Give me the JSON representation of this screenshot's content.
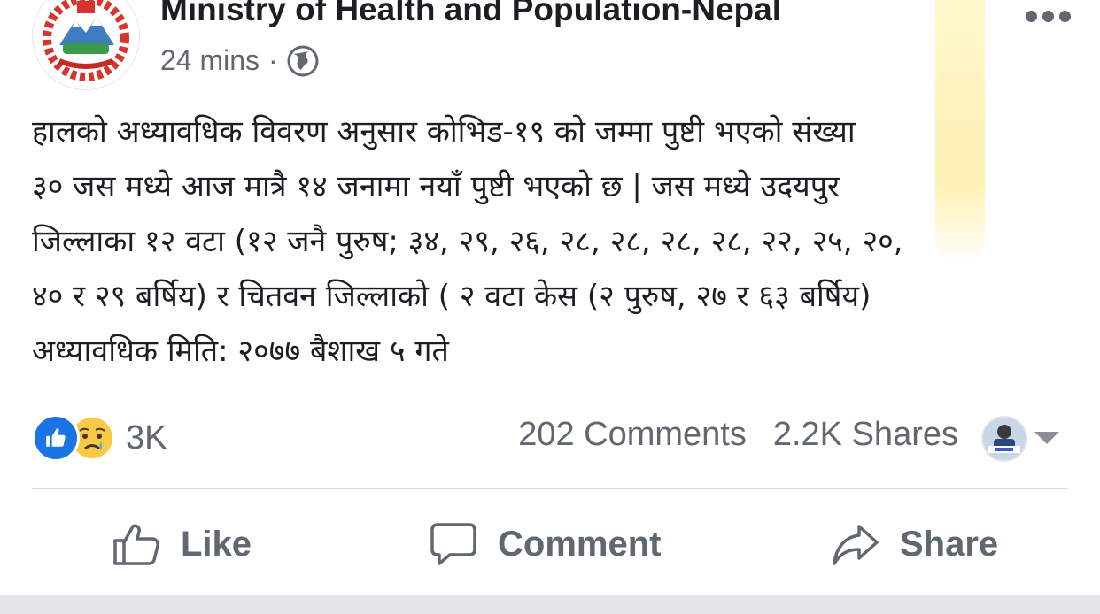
{
  "post": {
    "page_name": "Ministry of Health and Population-Nepal",
    "time": "24 mins",
    "separator": "·",
    "privacy_icon": "globe-icon",
    "text_lines": [
      "हालको अध्यावधिक विवरण अनुसार कोभिड-१९ को जम्मा पुष्टी भएको संख्या",
      "३० जस मध्ये आज मात्रै १४ जनामा नयाँ पुष्टी भएको छ | जस मध्ये उदयपुर",
      "जिल्लाका १२ वटा (१२ जनै पुरुष; ३४, २९, २६, २८, २८, २८, २८, २२, २५, २०,",
      "४० र २९ बर्षिय) र चितवन जिल्लाको ( २ वटा केस (२ पुरुष, २७ र ६३ बर्षिय)",
      "अध्यावधिक मिति: २०७७ बैशाख ५ गते"
    ]
  },
  "stats": {
    "reaction_count": "3K",
    "comments": "202 Comments",
    "shares": "2.2K Shares"
  },
  "actions": {
    "like": "Like",
    "comment": "Comment",
    "share": "Share"
  },
  "colors": {
    "like_blue": "#1b74e4",
    "muted_text": "#606770",
    "highlight": "#ffe98c"
  }
}
